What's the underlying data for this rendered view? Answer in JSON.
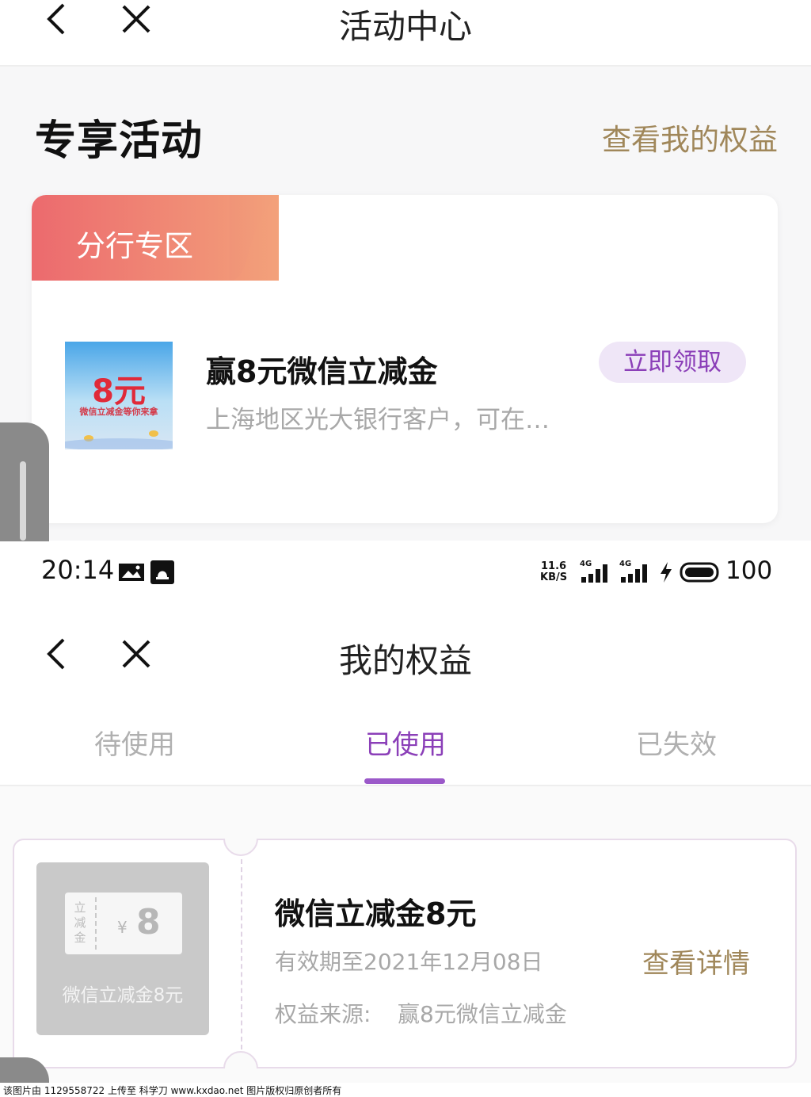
{
  "activity_page": {
    "nav_title": "活动中心",
    "section_title": "专享活动",
    "view_rights_link": "查看我的权益",
    "card": {
      "zone_label": "分行专区",
      "thumbnail": {
        "amount": "8元",
        "caption": "微信立减金等你来拿"
      },
      "title": "赢8元微信立减金",
      "description": "上海地区光大银行客户，可在…",
      "claim_button": "立即领取"
    }
  },
  "status_bar": {
    "time": "20:14",
    "speed_top": "11.6",
    "speed_bottom": "KB/S",
    "network1": "4G",
    "network2": "4G",
    "battery": "100"
  },
  "rights_page": {
    "nav_title": "我的权益",
    "tabs": [
      {
        "label": "待使用",
        "active": false
      },
      {
        "label": "已使用",
        "active": true
      },
      {
        "label": "已失效",
        "active": false
      }
    ],
    "coupon": {
      "ticket_vertical": "立减金",
      "ticket_yen": "¥",
      "ticket_amount": "8",
      "image_label": "微信立减金8元",
      "title": "微信立减金8元",
      "expiry": "有效期至2021年12月08日",
      "source_label": "权益来源:",
      "source_value": "赢8元微信立减金",
      "detail_link": "查看详情"
    }
  },
  "watermark": "该图片由 1129558722 上传至 科学刀 www.kxdao.net 图片版权归原创者所有",
  "colors": {
    "accent_purple": "#8b3fb8",
    "gold_link": "#a0875a",
    "banner_start": "#ec6a6e",
    "banner_end": "#f3a17a"
  }
}
